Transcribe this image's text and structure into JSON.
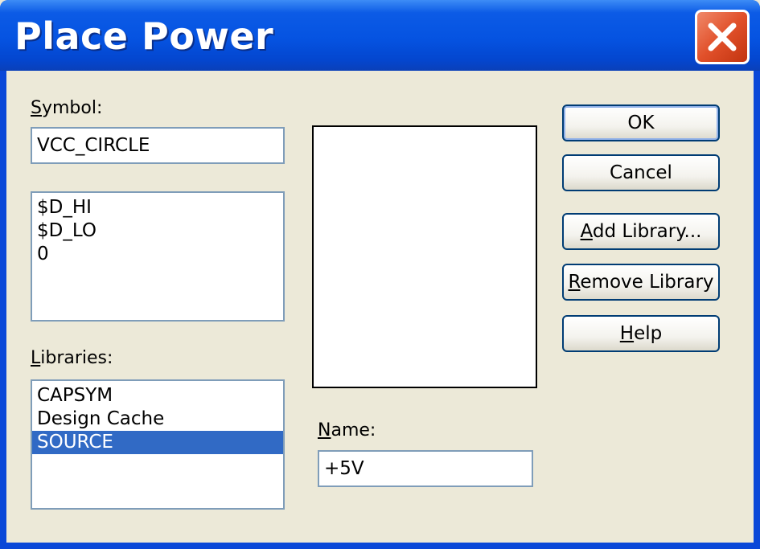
{
  "window": {
    "title": "Place Power"
  },
  "symbol": {
    "label_mnemonic": "S",
    "label_rest": "ymbol:",
    "value": "VCC_CIRCLE",
    "items": [
      "$D_HI",
      "$D_LO",
      "0"
    ]
  },
  "libraries": {
    "label_mnemonic": "L",
    "label_rest": "ibraries:",
    "items": [
      "CAPSYM",
      "Design Cache",
      "SOURCE"
    ],
    "selected": "SOURCE"
  },
  "name": {
    "label_mnemonic": "N",
    "label_rest": "ame:",
    "value": "+5V"
  },
  "buttons": {
    "ok": "OK",
    "cancel": "Cancel",
    "add_library_mnemonic": "A",
    "add_library_rest": "dd Library...",
    "remove_library_mnemonic": "R",
    "remove_library_rest": "emove Library",
    "help_mnemonic": "H",
    "help_rest": "elp"
  },
  "icons": {
    "close": "close-icon"
  },
  "colors": {
    "titlebar": "#0553e1",
    "close_button": "#e1502a",
    "selection": "#316ac5",
    "dialog_bg": "#ece9d8"
  }
}
